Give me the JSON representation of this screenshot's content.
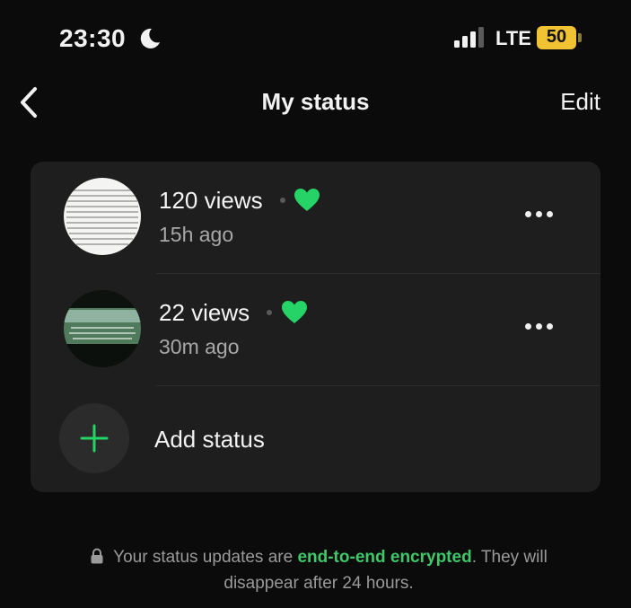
{
  "statusbar": {
    "time": "23:30",
    "network": "LTE",
    "battery": "50",
    "icons": {
      "moon": "moon-icon",
      "signal": "signal-bars-icon",
      "battery": "battery-charging-icon"
    }
  },
  "nav": {
    "back_icon": "chevron-left-icon",
    "title": "My status",
    "edit_label": "Edit"
  },
  "statuses": [
    {
      "views": "120 views",
      "time_ago": "15h ago",
      "reaction": "green-heart-icon",
      "more": "more-horizontal-icon"
    },
    {
      "views": "22 views",
      "time_ago": "30m ago",
      "reaction": "green-heart-icon",
      "more": "more-horizontal-icon"
    }
  ],
  "add_status": {
    "label": "Add status",
    "icon": "plus-icon"
  },
  "footer": {
    "lock_icon": "lock-icon",
    "text_before": "Your status updates are ",
    "highlight": "end-to-end encrypted",
    "text_after": ". They will disappear after 24 hours."
  },
  "colors": {
    "background": "#0b0b0b",
    "card": "#1e1e1e",
    "accent_green": "#25d366",
    "link_green": "#3ec86a",
    "battery_yellow": "#f1c232"
  }
}
